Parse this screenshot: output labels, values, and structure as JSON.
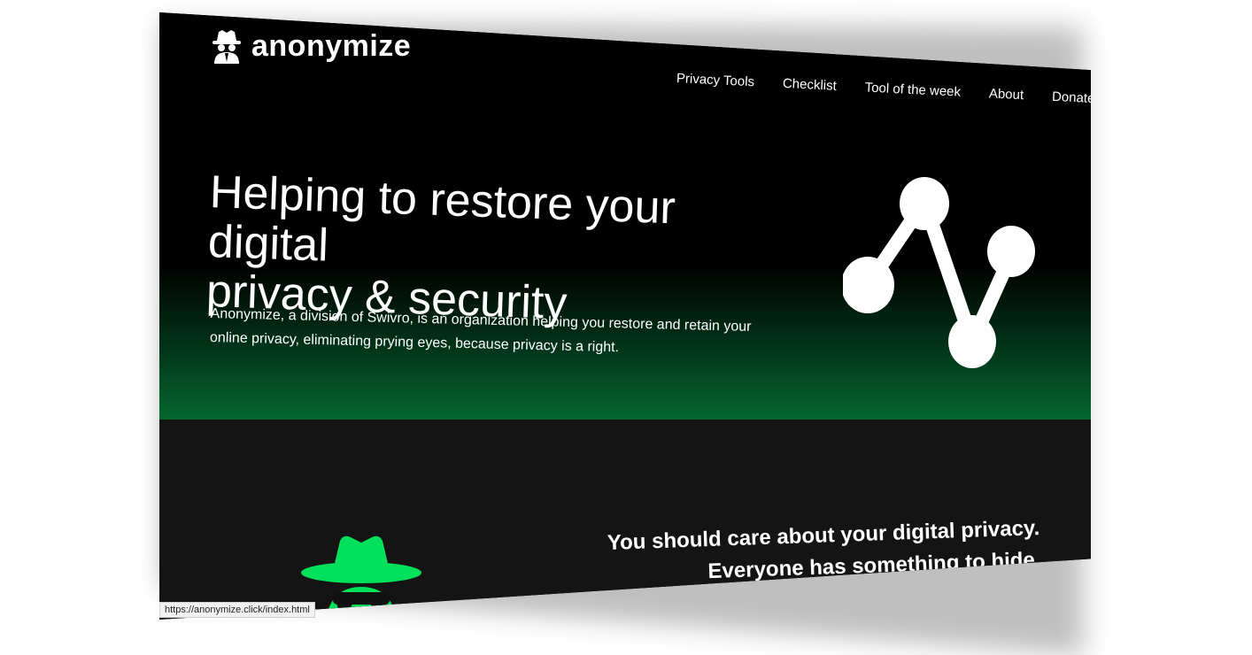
{
  "brand": {
    "name": "anonymize",
    "logo_icon": "spy-icon"
  },
  "nav": {
    "items": [
      {
        "label": "Privacy Tools"
      },
      {
        "label": "Checklist"
      },
      {
        "label": "Tool of the week"
      },
      {
        "label": "About"
      },
      {
        "label": "Donate"
      }
    ]
  },
  "hero": {
    "headline_line1": "Helping to restore your digital",
    "headline_line2": "privacy & security",
    "subtext": "Anonymize, a division of Swivro, is an organization helping you restore and retain your online privacy, eliminating prying eyes, because privacy is a right.",
    "graphic_icon": "share-network-icon"
  },
  "section": {
    "tagline_line1": "You should care about your digital privacy.",
    "tagline_line2": "Everyone has something to hide.",
    "illustration_icon": "spy-icon"
  },
  "status_bar": {
    "url": "https://anonymize.click/index.html"
  },
  "colors": {
    "accent": "#00e05a",
    "hero_gradient_end": "#077a36",
    "section_bg": "#141414"
  }
}
